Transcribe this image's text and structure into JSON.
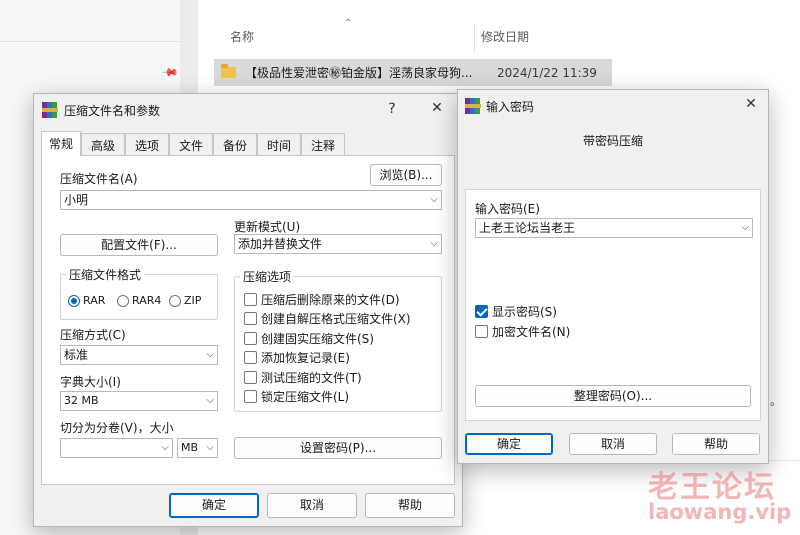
{
  "explorer": {
    "col_name": "名称",
    "col_date": "修改日期",
    "sort_arrow": "⌃",
    "file_name": "【极品性爱泄密㊙铂金版】淫荡良家母狗...",
    "file_date": "2024/1/22 11:39",
    "stray_char": "。"
  },
  "archive": {
    "title": "压缩文件名和参数",
    "help_glyph": "?",
    "close_glyph": "✕",
    "tabs": [
      "常规",
      "高级",
      "选项",
      "文件",
      "备份",
      "时间",
      "注释"
    ],
    "filename_label": "压缩文件名(A)",
    "browse_button": "浏览(B)...",
    "filename_value": "小明",
    "update_mode_label": "更新模式(U)",
    "update_mode_value": "添加并替换文件",
    "profiles_button": "配置文件(F)...",
    "format_group": "压缩文件格式",
    "formats": [
      "RAR",
      "RAR4",
      "ZIP"
    ],
    "options_group": "压缩选项",
    "options": [
      "压缩后删除原来的文件(D)",
      "创建自解压格式压缩文件(X)",
      "创建固实压缩文件(S)",
      "添加恢复记录(E)",
      "测试压缩的文件(T)",
      "锁定压缩文件(L)"
    ],
    "method_label": "压缩方式(C)",
    "method_value": "标准",
    "dict_label": "字典大小(I)",
    "dict_value": "32 MB",
    "split_label": "切分为分卷(V)，大小",
    "split_value": "",
    "split_unit": "MB",
    "set_password_button": "设置密码(P)...",
    "ok_button": "确定",
    "cancel_button": "取消",
    "help_button": "帮助"
  },
  "password": {
    "title": "输入密码",
    "close_glyph": "✕",
    "heading": "带密码压缩",
    "enter_label": "输入密码(E)",
    "password_value": "上老王论坛当老王",
    "show_password": "显示密码(S)",
    "encrypt_names": "加密文件名(N)",
    "organize_button": "整理密码(O)...",
    "ok_button": "确定",
    "cancel_button": "取消",
    "help_button": "帮助"
  },
  "watermark": {
    "title": "老王论坛",
    "url": "laowang.vip"
  }
}
